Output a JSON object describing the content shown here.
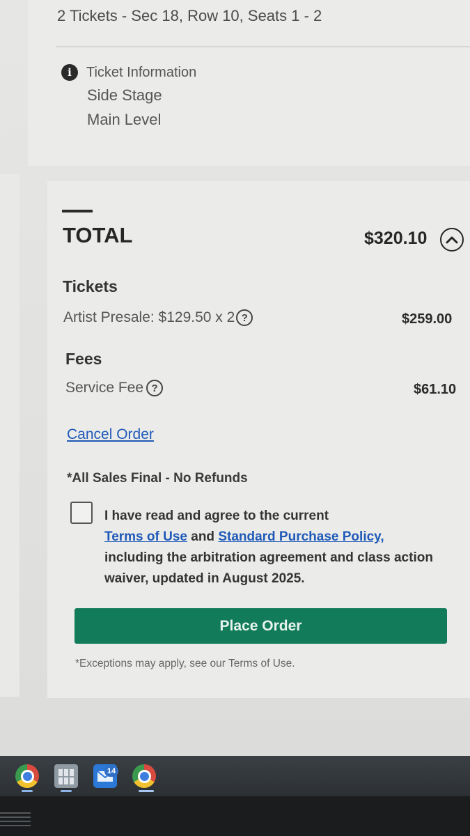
{
  "ticket_summary": {
    "header": "2 Tickets - Sec 18, Row 10, Seats 1 - 2",
    "info_title": "Ticket Information",
    "info_lines": [
      "Side Stage",
      "Main Level"
    ]
  },
  "order_total": {
    "label": "TOTAL",
    "amount": "$320.10",
    "tickets_heading": "Tickets",
    "ticket_line": {
      "label": "Artist Presale: $129.50 x 2",
      "amount": "$259.00"
    },
    "fees_heading": "Fees",
    "fee_line": {
      "label": "Service Fee",
      "amount": "$61.10"
    }
  },
  "actions": {
    "cancel_label": "Cancel Order",
    "sales_final": "*All Sales Final - No Refunds",
    "agree_prefix": "I have read and agree to the current",
    "terms_link": "Terms of Use",
    "and_text": "and",
    "policy_link": "Standard Purchase Policy,",
    "agree_suffix": "including the arbitration agreement and class action waiver, updated in August 2025.",
    "agreed": false,
    "place_order_label": "Place Order",
    "exceptions_note": "*Exceptions may apply, see our Terms of Use."
  },
  "taskbar": {
    "mail_badge": "14",
    "apps": [
      "chrome-icon",
      "calculator-icon",
      "mail-icon",
      "chrome-profile-icon"
    ]
  },
  "colors": {
    "accent_green": "#127c5a",
    "link_blue": "#1f5ab8"
  }
}
